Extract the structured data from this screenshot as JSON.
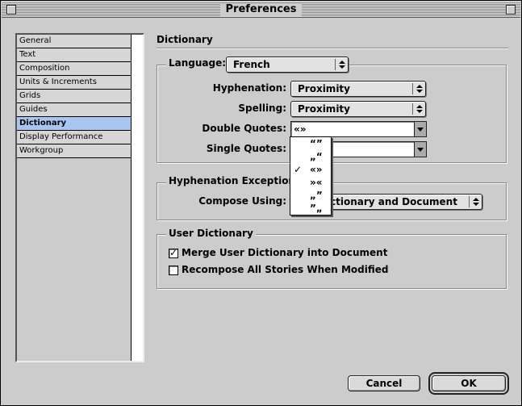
{
  "window": {
    "title": "Preferences"
  },
  "sidebar": {
    "items": [
      {
        "label": "General"
      },
      {
        "label": "Text"
      },
      {
        "label": "Composition"
      },
      {
        "label": "Units & Increments"
      },
      {
        "label": "Grids"
      },
      {
        "label": "Guides"
      },
      {
        "label": "Dictionary",
        "selected": true
      },
      {
        "label": "Display Performance"
      },
      {
        "label": "Workgroup"
      }
    ]
  },
  "panel": {
    "title": "Dictionary",
    "language": {
      "label": "Language:",
      "value": "French"
    },
    "hyphenation": {
      "label": "Hyphenation:",
      "value": "Proximity"
    },
    "spelling": {
      "label": "Spelling:",
      "value": "Proximity"
    },
    "double_quotes": {
      "label": "Double Quotes:",
      "value": "«»",
      "menu": [
        {
          "label": "“”",
          "checked": false
        },
        {
          "label": "„“",
          "checked": false
        },
        {
          "label": "«»",
          "checked": true
        },
        {
          "label": "»«",
          "checked": false
        },
        {
          "label": "„”",
          "checked": false
        },
        {
          "label": "”„",
          "checked": false
        }
      ]
    },
    "single_quotes": {
      "label": "Single Quotes:",
      "value": ""
    },
    "hyphenation_exceptions": {
      "title": "Hyphenation Exceptions",
      "compose_label": "Compose Using:",
      "compose_value": "User Dictionary and Document",
      "compose_value_visible": "ctionary and Document"
    },
    "user_dictionary": {
      "title": "User Dictionary",
      "merge": {
        "label": "Merge User Dictionary into Document",
        "checked": true
      },
      "recompose": {
        "label": "Recompose All Stories When Modified",
        "checked": false
      }
    }
  },
  "buttons": {
    "cancel": "Cancel",
    "ok": "OK"
  },
  "colors": {
    "selection": "#a9c6f0",
    "window": "#cccccc"
  }
}
